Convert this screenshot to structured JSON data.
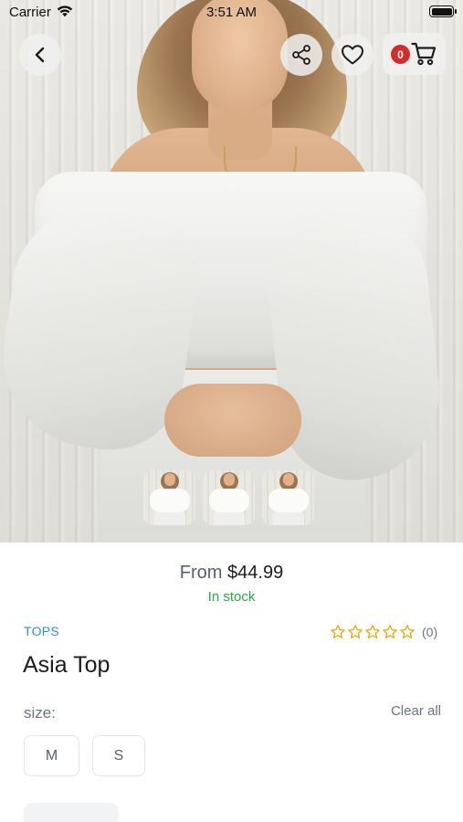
{
  "status_bar": {
    "carrier": "Carrier",
    "time": "3:51 AM"
  },
  "header": {
    "cart_count": "0"
  },
  "product": {
    "price_prefix": "From",
    "price": "$44.99",
    "stock_status": "In stock",
    "category": "TOPS",
    "title": "Asia Top",
    "rating_stars": 0,
    "rating_max": 5,
    "review_count": "(0)"
  },
  "size_selector": {
    "label": "size:",
    "clear_label": "Clear all",
    "options": [
      "M",
      "S"
    ]
  },
  "icons": {
    "back": "chevron-left-icon",
    "share": "share-icon",
    "wishlist": "heart-icon",
    "cart": "cart-icon",
    "star": "star-outline-icon"
  },
  "colors": {
    "accent_blue": "#2d8fd6",
    "stock_green": "#28a745",
    "badge_red": "#d52b2b",
    "star_gold": "#f0a500"
  }
}
